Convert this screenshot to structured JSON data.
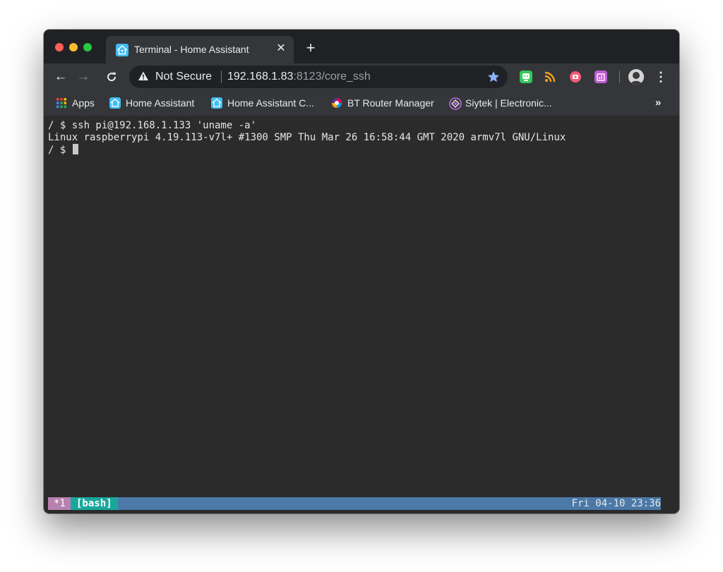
{
  "browser": {
    "tab": {
      "title": "Terminal - Home Assistant",
      "close_label": "✕"
    },
    "new_tab_label": "+",
    "toolbar": {
      "back_label": "←",
      "forward_label": "→",
      "reload_label": "C",
      "security_label": "Not Secure",
      "url_host": "192.168.1.83",
      "url_rest": ":8123/core_ssh",
      "menu_label": "⋮"
    },
    "bookmarks": [
      {
        "label": "Apps",
        "icon": "apps-grid-icon"
      },
      {
        "label": "Home Assistant",
        "icon": "home-assistant-icon"
      },
      {
        "label": "Home Assistant C...",
        "icon": "home-assistant-icon"
      },
      {
        "label": "BT Router Manager",
        "icon": "bt-logo-icon"
      },
      {
        "label": "Siytek | Electronic...",
        "icon": "siytek-logo-icon"
      }
    ],
    "bookmarks_overflow_label": "»"
  },
  "terminal": {
    "lines": [
      "/ $ ssh pi@192.168.1.133 'uname -a'",
      "Linux raspberrypi 4.19.113-v7l+ #1300 SMP Thu Mar 26 16:58:44 GMT 2020 armv7l GNU/Linux",
      "/ $ "
    ],
    "status": {
      "session": "*1",
      "window": "[bash]",
      "clock": "Fri 04-10 23:36"
    }
  },
  "colors": {
    "accent_blue": "#4b79a8",
    "session_pink": "#b880b0",
    "window_teal": "#1aa79b",
    "star_blue": "#8ab4f8"
  }
}
